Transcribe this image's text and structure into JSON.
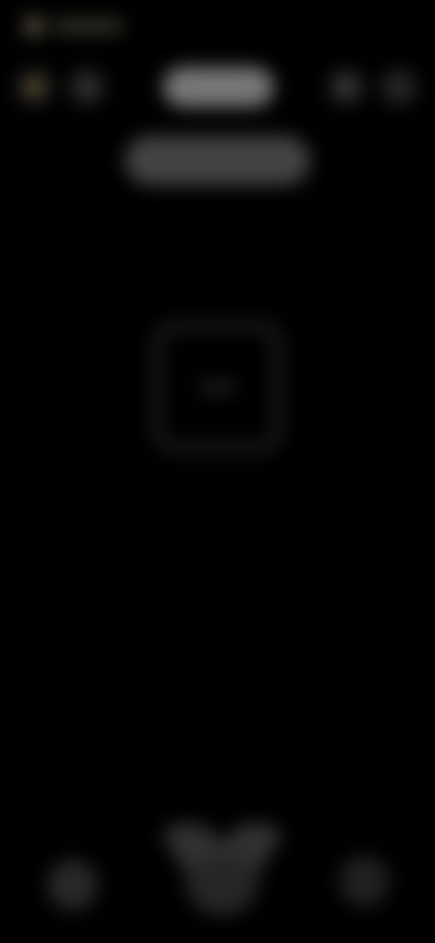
{
  "top_bar": {
    "primary_pill": "",
    "secondary_pill": ""
  },
  "icons": {
    "left_1": "flash-icon",
    "left_2": "timer-icon",
    "right_1": "settings-icon",
    "right_2": "more-icon",
    "center_frame": "focus-frame-icon",
    "bottom_left": "gallery-icon",
    "bottom_center": "shutter-icon",
    "bottom_right": "switch-camera-icon"
  },
  "colors": {
    "background": "#000000"
  }
}
